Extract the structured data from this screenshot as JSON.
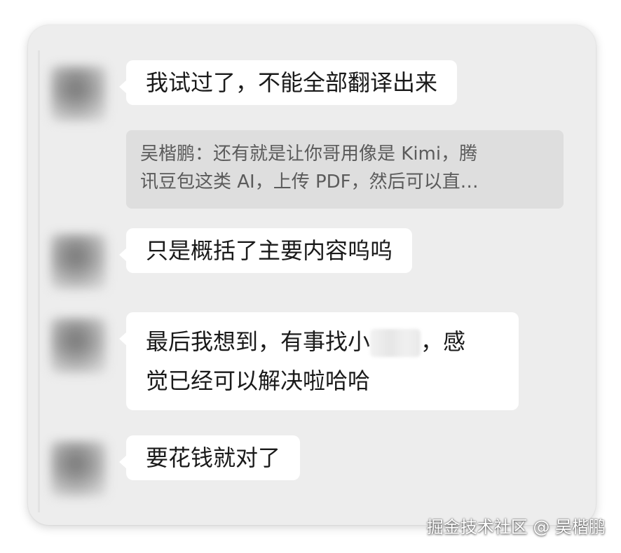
{
  "messages": [
    {
      "text": "我试过了，不能全部翻译出来"
    },
    {
      "quote": {
        "sender": "吴楷鹏",
        "line1": "吴楷鹏：还有就是让你哥用像是 Kimi，腾",
        "line2": "讯豆包这类 AI，上传 PDF，然后可以直…"
      }
    },
    {
      "text": "只是概括了主要内容呜呜"
    },
    {
      "line1_before": "最后我想到，有事找小",
      "line1_after": "，感",
      "line2": "觉已经可以解决啦哈哈"
    },
    {
      "text": "要花钱就对了"
    }
  ],
  "watermark": "掘金技术社区 @ 吴楷鹏",
  "colors": {
    "background": "#ededed",
    "bubble": "#ffffff",
    "quote_bg": "#dedede",
    "text": "#1a1a1a",
    "quote_text": "#5b5b5b"
  }
}
